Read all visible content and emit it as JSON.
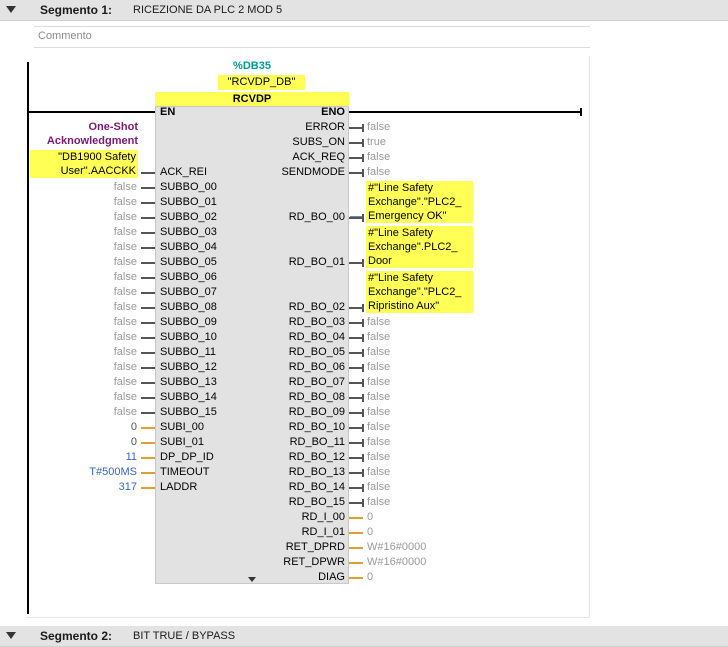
{
  "segment1": {
    "label": "Segmento 1:",
    "title": "RICEZIONE DA PLC 2 MOD 5",
    "comment_placeholder": "Commento"
  },
  "segment2": {
    "label": "Segmento 2:",
    "title": "BIT TRUE / BYPASS"
  },
  "block": {
    "db_name": "%DB35",
    "instance": "\"RCVDP_DB\"",
    "type": "RCVDP",
    "en": "EN",
    "eno": "ENO"
  },
  "ack_operand": {
    "title_line1": "One-Shot",
    "title_line2": "Acknowledgment",
    "var_line1": "\"DB1900 Safety",
    "var_line2": "User\".AACCKK"
  },
  "inputs": [
    {
      "pin": "ACK_REI",
      "value": "",
      "kind": "bool"
    },
    {
      "pin": "SUBBO_00",
      "value": "false",
      "kind": "bool"
    },
    {
      "pin": "SUBBO_01",
      "value": "false",
      "kind": "bool"
    },
    {
      "pin": "SUBBO_02",
      "value": "false",
      "kind": "bool"
    },
    {
      "pin": "SUBBO_03",
      "value": "false",
      "kind": "bool"
    },
    {
      "pin": "SUBBO_04",
      "value": "false",
      "kind": "bool"
    },
    {
      "pin": "SUBBO_05",
      "value": "false",
      "kind": "bool"
    },
    {
      "pin": "SUBBO_06",
      "value": "false",
      "kind": "bool"
    },
    {
      "pin": "SUBBO_07",
      "value": "false",
      "kind": "bool"
    },
    {
      "pin": "SUBBO_08",
      "value": "false",
      "kind": "bool"
    },
    {
      "pin": "SUBBO_09",
      "value": "false",
      "kind": "bool"
    },
    {
      "pin": "SUBBO_10",
      "value": "false",
      "kind": "bool"
    },
    {
      "pin": "SUBBO_11",
      "value": "false",
      "kind": "bool"
    },
    {
      "pin": "SUBBO_12",
      "value": "false",
      "kind": "bool"
    },
    {
      "pin": "SUBBO_13",
      "value": "false",
      "kind": "bool"
    },
    {
      "pin": "SUBBO_14",
      "value": "false",
      "kind": "bool"
    },
    {
      "pin": "SUBBO_15",
      "value": "false",
      "kind": "bool"
    },
    {
      "pin": "SUBI_00",
      "value": "0",
      "kind": "num"
    },
    {
      "pin": "SUBI_01",
      "value": "0",
      "kind": "num"
    },
    {
      "pin": "DP_DP_ID",
      "value": "11",
      "kind": "blue"
    },
    {
      "pin": "TIMEOUT",
      "value": "T#500MS",
      "kind": "blue"
    },
    {
      "pin": "LADDR",
      "value": "317",
      "kind": "blue"
    }
  ],
  "outputs_top": [
    {
      "pin": "ERROR",
      "value": "false",
      "kind": "bool"
    },
    {
      "pin": "SUBS_ON",
      "value": "true",
      "kind": "bool"
    },
    {
      "pin": "ACK_REQ",
      "value": "false",
      "kind": "bool"
    },
    {
      "pin": "SENDMODE",
      "value": "false",
      "kind": "bool"
    }
  ],
  "outputs_named": [
    {
      "pin": "RD_BO_00",
      "line1": "#\"Line Safety",
      "line2": "Exchange\".\"PLC2_",
      "line3": "Emergency OK\""
    },
    {
      "pin": "RD_BO_01",
      "line1": "#\"Line Safety",
      "line2": "Exchange\".PLC2_",
      "line3": "Door"
    },
    {
      "pin": "RD_BO_02",
      "line1": "#\"Line Safety",
      "line2": "Exchange\".\"PLC2_",
      "line3": "Ripristino Aux\""
    }
  ],
  "outputs_bottom": [
    {
      "pin": "RD_BO_03",
      "value": "false",
      "kind": "bool"
    },
    {
      "pin": "RD_BO_04",
      "value": "false",
      "kind": "bool"
    },
    {
      "pin": "RD_BO_05",
      "value": "false",
      "kind": "bool"
    },
    {
      "pin": "RD_BO_06",
      "value": "false",
      "kind": "bool"
    },
    {
      "pin": "RD_BO_07",
      "value": "false",
      "kind": "bool"
    },
    {
      "pin": "RD_BO_08",
      "value": "false",
      "kind": "bool"
    },
    {
      "pin": "RD_BO_09",
      "value": "false",
      "kind": "bool"
    },
    {
      "pin": "RD_BO_10",
      "value": "false",
      "kind": "bool"
    },
    {
      "pin": "RD_BO_11",
      "value": "false",
      "kind": "bool"
    },
    {
      "pin": "RD_BO_12",
      "value": "false",
      "kind": "bool"
    },
    {
      "pin": "RD_BO_13",
      "value": "false",
      "kind": "bool"
    },
    {
      "pin": "RD_BO_14",
      "value": "false",
      "kind": "bool"
    },
    {
      "pin": "RD_BO_15",
      "value": "false",
      "kind": "bool"
    },
    {
      "pin": "RD_I_00",
      "value": "0",
      "kind": "num"
    },
    {
      "pin": "RD_I_01",
      "value": "0",
      "kind": "num"
    },
    {
      "pin": "RET_DPRD",
      "value": "W#16#0000",
      "kind": "num"
    },
    {
      "pin": "RET_DPWR",
      "value": "W#16#0000",
      "kind": "num"
    },
    {
      "pin": "DIAG",
      "value": "0",
      "kind": "num"
    }
  ],
  "icons": {
    "segment_collapse": "chevron-down-icon",
    "block_expand": "chevron-down-icon"
  }
}
